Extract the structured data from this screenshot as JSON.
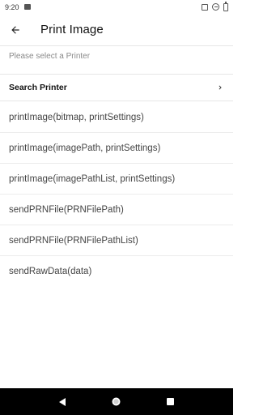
{
  "status_bar": {
    "time": "9:20",
    "icons": [
      "notification-image-icon",
      "vibrate-icon",
      "do-not-disturb-icon",
      "battery-icon"
    ]
  },
  "app_bar": {
    "title": "Print Image",
    "back_icon": "arrow-left-icon"
  },
  "section_hint": "Please select a Printer",
  "search_printer": {
    "label": "Search Printer",
    "icon": "chevron-right-icon"
  },
  "methods": [
    "printImage(bitmap, printSettings)",
    "printImage(imagePath, printSettings)",
    "printImage(imagePathList, printSettings)",
    "sendPRNFile(PRNFilePath)",
    "sendPRNFile(PRNFilePathList)",
    "sendRawData(data)"
  ],
  "nav_bar": {
    "buttons": [
      "back-triangle-icon",
      "home-circle-icon",
      "recents-square-icon"
    ]
  },
  "colors": {
    "background": "#ffffff",
    "divider": "#e6e6e6",
    "hint_text": "#8a8a8a",
    "nav_bar": "#000000"
  }
}
